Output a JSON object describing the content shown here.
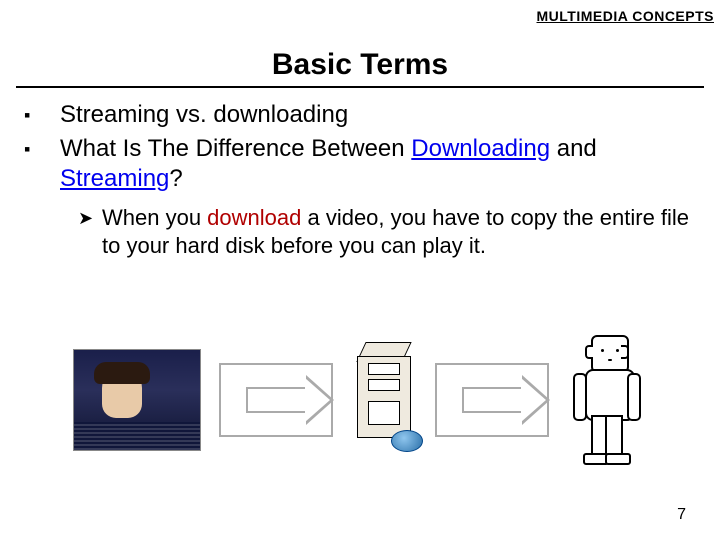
{
  "header": {
    "label": "MULTIMEDIA CONCEPTS"
  },
  "title": "Basic Terms",
  "bullets": [
    {
      "text": "Streaming vs. downloading"
    },
    {
      "pre": "What Is The Difference Between ",
      "link1": "Downloading",
      "mid": " and ",
      "link2": "Streaming",
      "post": "?"
    }
  ],
  "sub": {
    "pre": "When you ",
    "emph": "download",
    "post": " a video, you have to copy the entire file to your hard disk before you can play it."
  },
  "page": "7"
}
